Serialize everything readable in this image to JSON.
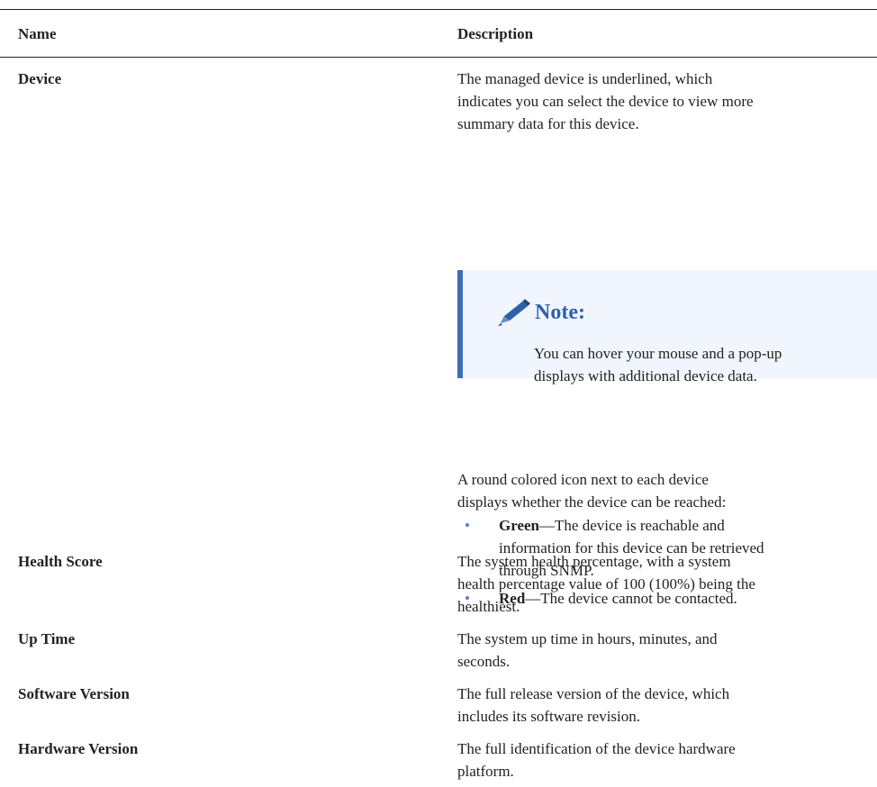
{
  "table": {
    "headers": {
      "name": "Name",
      "description": "Description"
    },
    "rows": [
      {
        "name": "Device",
        "description_lines": [
          "The managed device is underlined, which",
          "indicates you can select the device to view more",
          "summary data for this device."
        ]
      },
      {
        "name": "Health Score",
        "description_lines": [
          "The system health percentage, with a system",
          "health percentage value of 100 (100%) being the",
          "healthiest."
        ]
      },
      {
        "name": "Up Time",
        "description_lines": [
          "The system up time in hours, minutes, and",
          "seconds."
        ]
      },
      {
        "name": "Software Version",
        "description_lines": [
          "The full release version of the device, which",
          "includes its software revision."
        ]
      },
      {
        "name": "Hardware Version",
        "description_lines": [
          "The full identification of the device hardware",
          "platform."
        ]
      }
    ]
  },
  "note": {
    "icon": "pencil-icon",
    "title": "Note:",
    "body_lines": [
      "You can hover your mouse and a pop-up",
      "displays with additional device data."
    ]
  },
  "device_icon_text": {
    "intro_lines": [
      "A round colored icon next to each device",
      "displays whether the device can be reached:"
    ],
    "bullets": [
      {
        "term": "Green",
        "text_lines": [
          "—The device is reachable and",
          "information for this device can be retrieved",
          "through SNMP."
        ]
      },
      {
        "term": "Red",
        "text_lines": [
          "—The device cannot be contacted."
        ]
      }
    ]
  },
  "colors": {
    "note_accent": "#3d6eb4",
    "note_background": "#f1f5fd",
    "note_title": "#2d62aa",
    "bullet": "#5a7fb8"
  }
}
